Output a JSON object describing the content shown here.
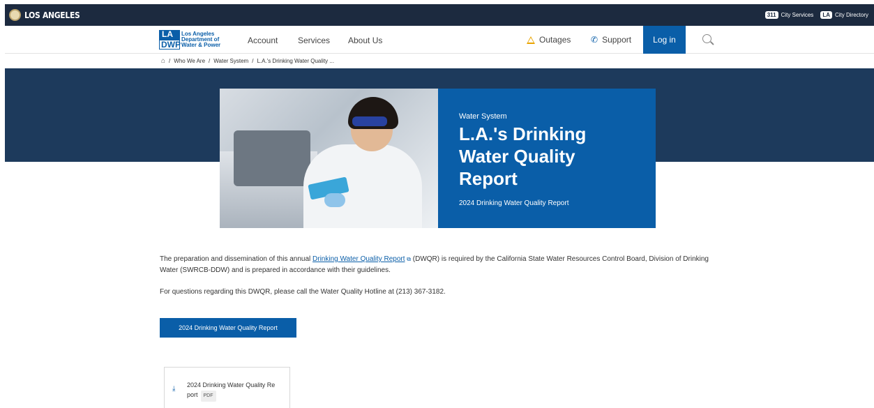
{
  "citybar": {
    "name": "LOS ANGELES",
    "links": [
      {
        "badge": "311",
        "label": "City Services"
      },
      {
        "badge": "LA",
        "label": "City Directory"
      }
    ]
  },
  "logo": {
    "line1": "LA",
    "line2": "DWP",
    "text1": "Los Angeles",
    "text2": "Department of",
    "text3": "Water & Power"
  },
  "nav": {
    "account": "Account",
    "services": "Services",
    "about": "About Us",
    "outages": "Outages",
    "support": "Support",
    "login": "Log in"
  },
  "breadcrumb": {
    "items": [
      "Who We Are",
      "Water System",
      "L.A.'s Drinking Water Quality ..."
    ],
    "separator": "/"
  },
  "hero": {
    "eyebrow": "Water System",
    "title": "L.A.'s Drinking Water Quality Report",
    "subtitle": "2024 Drinking Water Quality Report"
  },
  "body": {
    "p1_before": "The preparation and dissemination of this annual ",
    "p1_link": "Drinking Water Quality Report",
    "p1_after": " (DWQR) is required by the California State Water Resources Control Board, Division of Drinking Water (SWRCB-DDW) and is prepared in accordance with their guidelines.",
    "p2": "For questions regarding this DWQR, please call the Water Quality Hotline at (213) 367-3182.",
    "button": "2024 Drinking Water Quality Report",
    "file_title": "2024 Drinking Water Quality Re port",
    "file_type": "PDF"
  },
  "colors": {
    "brand_blue": "#0a5ea8",
    "citybar_bg": "#1c2a3f",
    "hero_band": "#1d3a5c",
    "warning": "#e9a400"
  }
}
